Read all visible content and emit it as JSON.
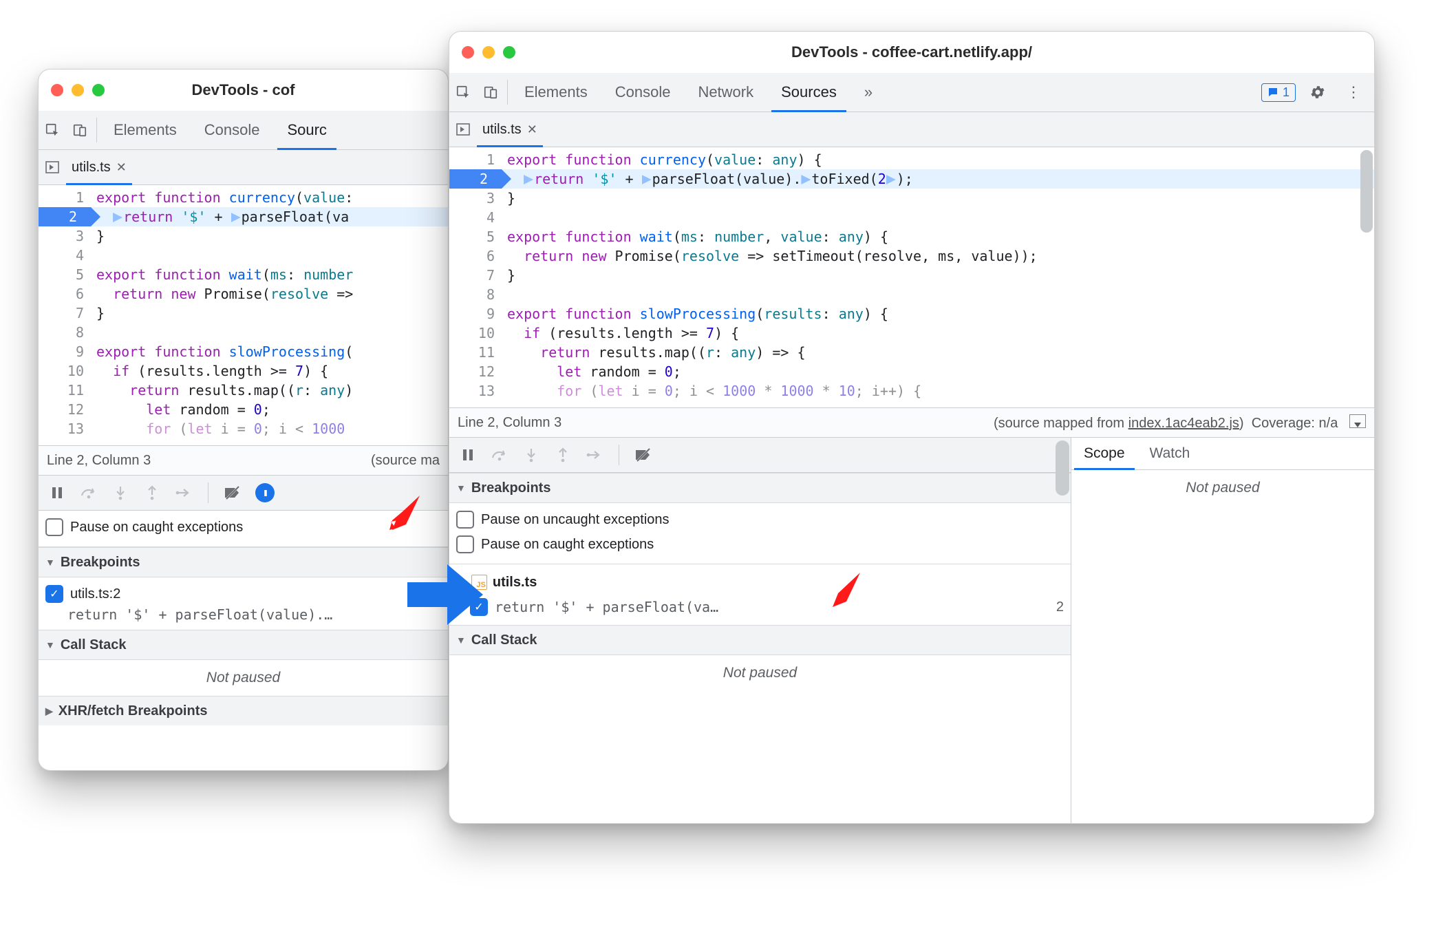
{
  "windowA": {
    "title": "DevTools - cof",
    "tabs": [
      "Elements",
      "Console",
      "Sourc"
    ],
    "active_tab": "Sourc",
    "open_file": "utils.ts",
    "code_lines": [
      {
        "n": 1,
        "html": "<span class='kw'>export</span> <span class='kw'>function</span> <span class='fn'>currency</span>(<span class='param'>value</span>:"
      },
      {
        "n": 2,
        "html": "<span class='step'></span><span class='kw'>return</span> <span class='str'>'$'</span> + <span class='step'></span>parseFloat(va",
        "exec": true,
        "indent": "  "
      },
      {
        "n": 3,
        "html": "}"
      },
      {
        "n": 4,
        "html": ""
      },
      {
        "n": 5,
        "html": "<span class='kw'>export</span> <span class='kw'>function</span> <span class='fn'>wait</span>(<span class='param'>ms</span>: <span class='type'>number</span>"
      },
      {
        "n": 6,
        "html": "<span class='kw'>return</span> <span class='kw'>new</span> Promise(<span class='param'>resolve</span> =>",
        "indent": "  "
      },
      {
        "n": 7,
        "html": "}"
      },
      {
        "n": 8,
        "html": ""
      },
      {
        "n": 9,
        "html": "<span class='kw'>export</span> <span class='kw'>function</span> <span class='fn'>slowProcessing</span>("
      },
      {
        "n": 10,
        "html": "<span class='kw'>if</span> (results.length &gt;= <span class='num'>7</span>) {",
        "indent": "  "
      },
      {
        "n": 11,
        "html": "<span class='kw'>return</span> results.map((<span class='param'>r</span>: <span class='type'>any</span>)",
        "indent": "    "
      },
      {
        "n": 12,
        "html": "<span class='kw'>let</span> random = <span class='num'>0</span>;",
        "indent": "      "
      },
      {
        "n": 13,
        "html": "<span class='kw'>for</span> (<span class='kw'>let</span> i = <span class='num'>0</span>; i &lt; <span class='num'>1000</span>",
        "indent": "      ",
        "cut": true
      }
    ],
    "status_left": "Line 2, Column 3",
    "status_right": "(source ma",
    "pause_caught": "Pause on caught exceptions",
    "breakpoints_header": "Breakpoints",
    "bp_file": "utils.ts:2",
    "bp_code": "return '$' + parseFloat(value).…",
    "callstack_header": "Call Stack",
    "not_paused": "Not paused",
    "xhr_header": "XHR/fetch Breakpoints"
  },
  "windowB": {
    "title": "DevTools - coffee-cart.netlify.app/",
    "tabs": [
      "Elements",
      "Console",
      "Network",
      "Sources"
    ],
    "active_tab": "Sources",
    "chip_count": "1",
    "open_file": "utils.ts",
    "code_lines": [
      {
        "n": 1,
        "html": "<span class='kw'>export</span> <span class='kw'>function</span> <span class='fn'>currency</span>(<span class='param'>value</span>: <span class='type'>any</span>) {"
      },
      {
        "n": 2,
        "html": "<span class='step'></span><span class='kw'>return</span> <span class='str'>'$'</span> + <span class='step'></span>parseFloat(value).<span class='step'></span>toFixed(<span class='num'>2</span><span class='step'></span>);",
        "exec": true,
        "indent": "  "
      },
      {
        "n": 3,
        "html": "}"
      },
      {
        "n": 4,
        "html": ""
      },
      {
        "n": 5,
        "html": "<span class='kw'>export</span> <span class='kw'>function</span> <span class='fn'>wait</span>(<span class='param'>ms</span>: <span class='type'>number</span>, <span class='param'>value</span>: <span class='type'>any</span>) {"
      },
      {
        "n": 6,
        "html": "<span class='kw'>return</span> <span class='kw'>new</span> Promise(<span class='param'>resolve</span> =&gt; setTimeout(resolve, ms, value));",
        "indent": "  "
      },
      {
        "n": 7,
        "html": "}"
      },
      {
        "n": 8,
        "html": ""
      },
      {
        "n": 9,
        "html": "<span class='kw'>export</span> <span class='kw'>function</span> <span class='fn'>slowProcessing</span>(<span class='param'>results</span>: <span class='type'>any</span>) {"
      },
      {
        "n": 10,
        "html": "<span class='kw'>if</span> (results.length &gt;= <span class='num'>7</span>) {",
        "indent": "  "
      },
      {
        "n": 11,
        "html": "<span class='kw'>return</span> results.map((<span class='param'>r</span>: <span class='type'>any</span>) =&gt; {",
        "indent": "    "
      },
      {
        "n": 12,
        "html": "<span class='kw'>let</span> random = <span class='num'>0</span>;",
        "indent": "      "
      },
      {
        "n": 13,
        "html": "<span class='kw'>for</span> (<span class='kw'>let</span> i = <span class='num'>0</span>; i &lt; <span class='num'>1000</span> * <span class='num'>1000</span> * <span class='num'>10</span>; i++) {",
        "indent": "      ",
        "cut": true
      }
    ],
    "status_left": "Line 2, Column 3",
    "status_mid_prefix": "(source mapped from ",
    "status_mid_link": "index.1ac4eab2.js",
    "status_mid_suffix": ")",
    "status_cov": "Coverage: n/a",
    "breakpoints_header": "Breakpoints",
    "pause_uncaught": "Pause on uncaught exceptions",
    "pause_caught": "Pause on caught exceptions",
    "bp_file": "utils.ts",
    "bp_code": "return '$' + parseFloat(va…",
    "bp_count": "2",
    "callstack_header": "Call Stack",
    "not_paused": "Not paused",
    "scope_tab": "Scope",
    "watch_tab": "Watch",
    "scope_not_paused": "Not paused"
  }
}
